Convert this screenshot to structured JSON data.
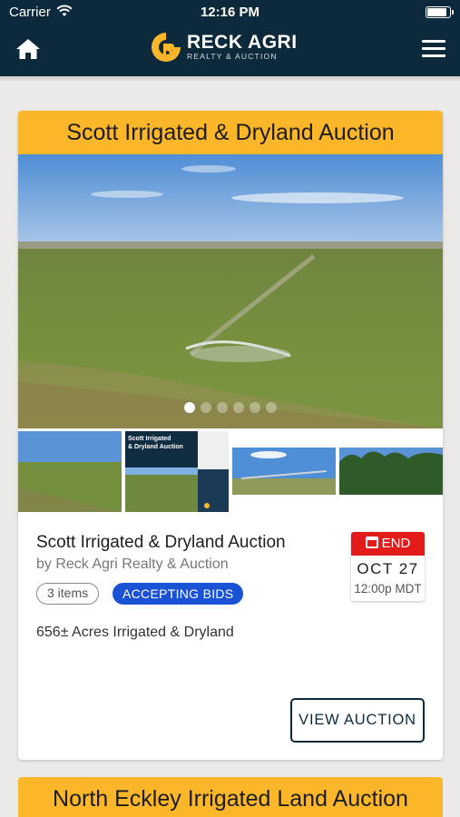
{
  "status_bar": {
    "carrier": "Carrier",
    "time": "12:16 PM",
    "battery_level": 0.9
  },
  "nav": {
    "logo_main": "RECK AGRI",
    "logo_sub": "REALTY & AUCTION",
    "home_icon": "home-icon",
    "menu_icon": "hamburger-menu-icon",
    "bar_color": "#0d2a3c",
    "brand_accent": "#fbb62a"
  },
  "auction": {
    "header_title": "Scott Irrigated & Dryland Auction",
    "title": "Scott Irrigated & Dryland Auction",
    "byline": "by Reck Agri Realty & Auction",
    "items_count": "3 items",
    "status_badge": "ACCEPTING BIDS",
    "description": "656± Acres Irrigated & Dryland",
    "end_label": "END",
    "end_date": "OCT 27",
    "end_time": "12:00p MDT",
    "view_button": "VIEW AUCTION",
    "carousel_dots": 6,
    "carousel_active": 1,
    "thumbnails": [
      "field-photo",
      "auction-brochure",
      "pivot-irrigation-photo",
      "tree-line-photo"
    ],
    "thumb_brochure": {
      "title_line1": "Scott Irrigated",
      "title_line2": "& Dryland Auction"
    }
  },
  "next_auction": {
    "header_title": "North Eckley Irrigated Land Auction"
  }
}
